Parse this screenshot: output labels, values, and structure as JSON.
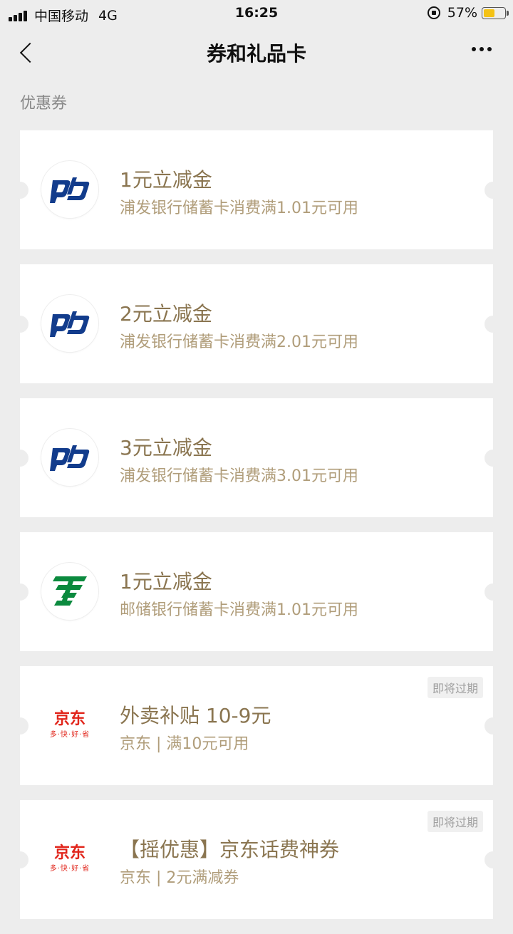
{
  "status_bar": {
    "carrier": "中国移动",
    "network": "4G",
    "time": "16:25",
    "battery": "57%",
    "battery_level": 0.57,
    "battery_color": "#f4c215"
  },
  "nav": {
    "title": "券和礼品卡",
    "back_icon": "chevron-left-icon",
    "more_icon": "more-dots-icon"
  },
  "section": {
    "title": "优惠券"
  },
  "coupons": [
    {
      "logo": "spdb-logo",
      "title": "1元立减金",
      "subtitle": "浦发银行储蓄卡消费满1.01元可用",
      "badge": ""
    },
    {
      "logo": "spdb-logo",
      "title": "2元立减金",
      "subtitle": "浦发银行储蓄卡消费满2.01元可用",
      "badge": ""
    },
    {
      "logo": "spdb-logo",
      "title": "3元立减金",
      "subtitle": "浦发银行储蓄卡消费满3.01元可用",
      "badge": ""
    },
    {
      "logo": "psbc-logo",
      "title": "1元立减金",
      "subtitle": "邮储银行储蓄卡消费满1.01元可用",
      "badge": ""
    },
    {
      "logo": "jd-logo",
      "logo_text": "京东",
      "logo_tagline": "多·快·好·省",
      "title": "外卖补贴 10-9元",
      "subtitle": "京东 | 满10元可用",
      "badge": "即将过期"
    },
    {
      "logo": "jd-logo",
      "logo_text": "京东",
      "logo_tagline": "多·快·好·省",
      "title": "【摇优惠】京东话费神券",
      "subtitle": "京东 | 2元满减券",
      "badge": "即将过期"
    }
  ],
  "colors": {
    "title": "#8a7550",
    "subtitle": "#b09d7a",
    "background": "#ededed",
    "spdb_blue": "#123c8c",
    "psbc_green": "#0b8a3e",
    "jd_red": "#e1251b"
  }
}
